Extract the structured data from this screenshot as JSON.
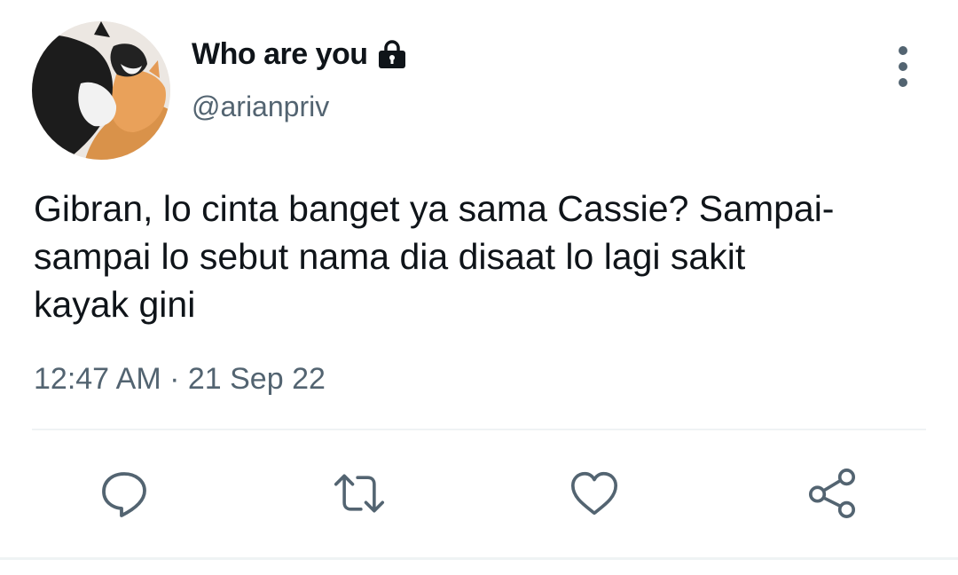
{
  "user": {
    "display_name": "Who are you",
    "handle": "@arianpriv",
    "protected_icon": "lock-icon"
  },
  "tweet": {
    "text": "Gibran, lo cinta banget ya sama Cassie? Sampai-\nsampai lo sebut nama dia disaat lo lagi sakit\nkayak gini",
    "timestamp": "12:47 AM · 21 Sep 22"
  },
  "actions": [
    {
      "icon": "reply-icon"
    },
    {
      "icon": "retweet-icon"
    },
    {
      "icon": "like-icon"
    },
    {
      "icon": "share-icon"
    }
  ],
  "colors": {
    "text": "#0f1419",
    "secondary": "#536471",
    "divider": "#eff3f4"
  }
}
